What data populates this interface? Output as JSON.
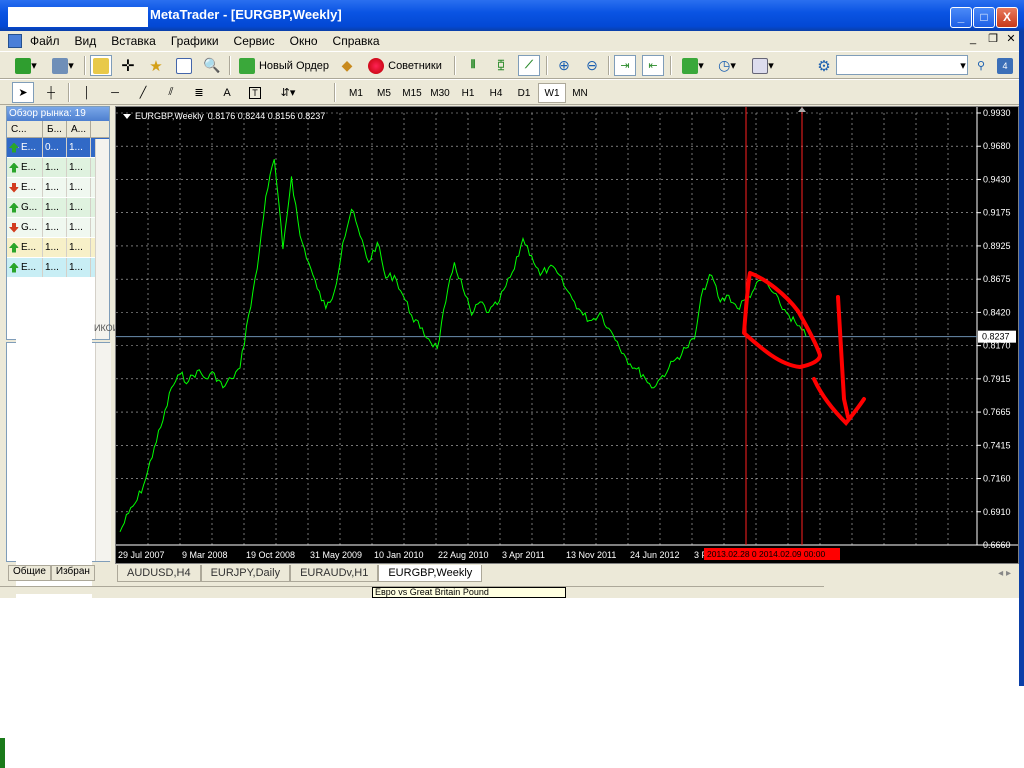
{
  "window": {
    "title": "MetaTrader - [EURGBP,Weekly]",
    "minimize": "_",
    "maximize": "□",
    "close": "X"
  },
  "menu": [
    "Файл",
    "Вид",
    "Вставка",
    "Графики",
    "Сервис",
    "Окно",
    "Справка"
  ],
  "toolbar": {
    "new_order": "Новый Ордер",
    "experts": "Советники",
    "search_value": ""
  },
  "timeframes": [
    "M1",
    "M5",
    "M15",
    "M30",
    "H1",
    "H4",
    "D1",
    "W1",
    "MN"
  ],
  "active_timeframe": "W1",
  "drawing_tools": {
    "text": "A",
    "label": "T"
  },
  "market_watch": {
    "header": "Обзор рынка: 19",
    "columns": [
      "С...",
      "Б...",
      "А..."
    ],
    "rows": [
      {
        "symbol": "E...",
        "bid": "0...",
        "ask": "1...",
        "dir": "up",
        "selected": true
      },
      {
        "symbol": "E...",
        "bid": "1...",
        "ask": "1...",
        "dir": "up"
      },
      {
        "symbol": "E...",
        "bid": "1...",
        "ask": "1...",
        "dir": "down"
      },
      {
        "symbol": "G...",
        "bid": "1...",
        "ask": "1...",
        "dir": "up"
      },
      {
        "symbol": "G...",
        "bid": "1...",
        "ask": "1...",
        "dir": "down"
      },
      {
        "symbol": "E...",
        "bid": "1...",
        "ask": "1...",
        "dir": "up"
      },
      {
        "symbol": "E...",
        "bid": "1...",
        "ask": "1...",
        "dir": "up"
      }
    ],
    "side_tab": "ИКОИ"
  },
  "left_tabs": [
    "Общие",
    "Избран"
  ],
  "chart": {
    "label_symbol": "EURGBP,Weekly",
    "label_ohlc": "0.8176 0.8244 0.8156 0.8237",
    "current_price": "0.8237",
    "period_label": "2013.02.28 0",
    "period_label2": "2014.02.09 00:00",
    "colors": {
      "background": "#000000",
      "line": "#00ff00",
      "grid": "#c0c0c0",
      "price_line": "#6c8fb0",
      "vline": "#ff2020",
      "annotation": "#ff0000"
    }
  },
  "chart_data": {
    "type": "line",
    "title": "EURGBP,Weekly",
    "y_ticks": [
      "0.9930",
      "0.9680",
      "0.9430",
      "0.9175",
      "0.8925",
      "0.8675",
      "0.8420",
      "0.8170",
      "0.7915",
      "0.7665",
      "0.7415",
      "0.7160",
      "0.6910",
      "0.6660"
    ],
    "x_ticks": [
      "29 Jul 2007",
      "9 Mar 2008",
      "19 Oct 2008",
      "31 May 2009",
      "10 Jan 2010",
      "22 Aug 2010",
      "3 Apr 2011",
      "13 Nov 2011",
      "24 Jun 2012",
      "3 F"
    ],
    "ylim": [
      0.666,
      0.993
    ],
    "series": [
      {
        "values": [
          0.676,
          0.69,
          0.7,
          0.716,
          0.74,
          0.76,
          0.785,
          0.795,
          0.79,
          0.798,
          0.792,
          0.796,
          0.785,
          0.792,
          0.8,
          0.84,
          0.875,
          0.93,
          0.958,
          0.89,
          0.945,
          0.9,
          0.88,
          0.86,
          0.845,
          0.858,
          0.895,
          0.92,
          0.9,
          0.88,
          0.895,
          0.868,
          0.87,
          0.855,
          0.84,
          0.83,
          0.822,
          0.815,
          0.85,
          0.88,
          0.86,
          0.84,
          0.85,
          0.842,
          0.848,
          0.862,
          0.875,
          0.898,
          0.885,
          0.87,
          0.876,
          0.872,
          0.86,
          0.85,
          0.84,
          0.836,
          0.842,
          0.83,
          0.82,
          0.808,
          0.8,
          0.795,
          0.785,
          0.792,
          0.8,
          0.808,
          0.815,
          0.822,
          0.86,
          0.87,
          0.85,
          0.855,
          0.845,
          0.852,
          0.86,
          0.868,
          0.858,
          0.848,
          0.84,
          0.832,
          0.824
        ]
      }
    ],
    "grid": true
  },
  "chart_tabs": [
    "AUDUSD,H4",
    "EURJPY,Daily",
    "EURAUDv,H1",
    "EURGBP,Weekly"
  ],
  "active_chart_tab": "EURGBP,Weekly",
  "tooltip": "Евро vs Great Britain Pound"
}
